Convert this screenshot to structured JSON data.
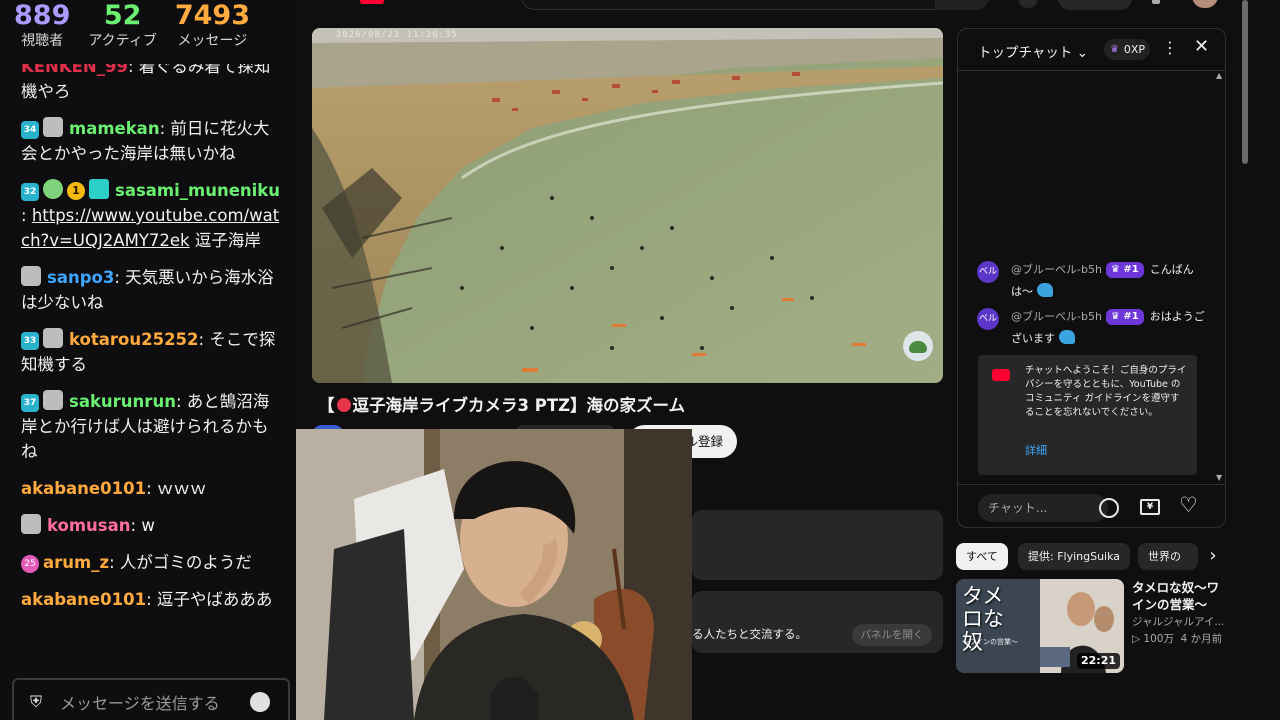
{
  "stream_stats": {
    "viewers": "889",
    "viewers_label": "視聴者",
    "active": "52",
    "active_label": "アクティブ",
    "messages": "7493",
    "messages_label": "メッセージ"
  },
  "stream_chat": {
    "messages": [
      {
        "user": "KENKEN_99",
        "color": "#e0314b",
        "text": "着ぐるみ着て探知機やろ"
      },
      {
        "badge": "34",
        "user": "mamekan",
        "color": "#6bf071",
        "text": "前日に花火大会とかやった海岸は無いかね"
      },
      {
        "badge": "32",
        "user": "sasami_muneniku",
        "color": "#6bf071",
        "link": "https://www.youtube.com/watch?v=UQJ2AMY72ek",
        "text": "逗子海岸"
      },
      {
        "user": "sanpo3",
        "color": "#3ea6ff",
        "text": "天気悪いから海水浴は少ないね"
      },
      {
        "badge": "33",
        "user": "kotarou25252",
        "color": "#ffaa3e",
        "text": "そこで探知機する"
      },
      {
        "badge": "37",
        "user": "sakurunrun",
        "color": "#6bf071",
        "text": "あと鵠沼海岸とか行けば人は避けられるかもね"
      },
      {
        "user": "akabane0101",
        "color": "#ffaa3e",
        "text": "ｗｗｗ"
      },
      {
        "user": "komusan",
        "color": "#ff6c9e",
        "text": "w"
      },
      {
        "badge": "25",
        "user": "arum_z",
        "color": "#ffaa3e",
        "text": "人がゴミのようだ"
      },
      {
        "user": "akabane0101",
        "color": "#ffaa3e",
        "text": "逗子やばあああ"
      }
    ],
    "input_placeholder": "メッセージを送信する",
    "badge_coin": "1"
  },
  "video": {
    "timestamp": "2026/08/23 11:36:35",
    "title_prefix": "【",
    "title_text": "逗子海岸ライブカメラ3 PTZ】海の家ズーム",
    "subscribe_label": "ル登録"
  },
  "panel_box": {
    "text": "る人たちと交流する。",
    "open_label": "パネルを開く"
  },
  "live_chat": {
    "mode_label": "トップチャット",
    "xp": "0XP",
    "messages": [
      {
        "avatar": "ベル",
        "author": "@ブルーベル-b5h",
        "rank": "#1",
        "text": "こんばんは〜"
      },
      {
        "avatar": "ベル",
        "author": "@ブルーベル-b5h",
        "rank": "#1",
        "text": "おはようございます"
      }
    ],
    "welcome_text": "チャットへようこそ！ご自身のプライバシーを守るとともに、YouTube のコミュニティ ガイドラインを遵守することを忘れないでください。",
    "welcome_more": "詳細",
    "input_placeholder": "チャット...",
    "super_chat_icon_text": "¥"
  },
  "chips": [
    "すべて",
    "提供: FlyingSuika",
    "世界の"
  ],
  "related_video": {
    "title": "タメロな奴〜ワインの営業〜",
    "channel": "ジャルジャルアイ...",
    "views": "100万",
    "age": "4 か月前",
    "duration": "22:21",
    "thumb_text": "タメロな奴",
    "thumb_subtext": "〜ワインの営業〜"
  },
  "colors": {
    "accent_red": "#ff0033",
    "rank_purple": "#6c36d9",
    "link_blue": "#3ea6ff"
  }
}
